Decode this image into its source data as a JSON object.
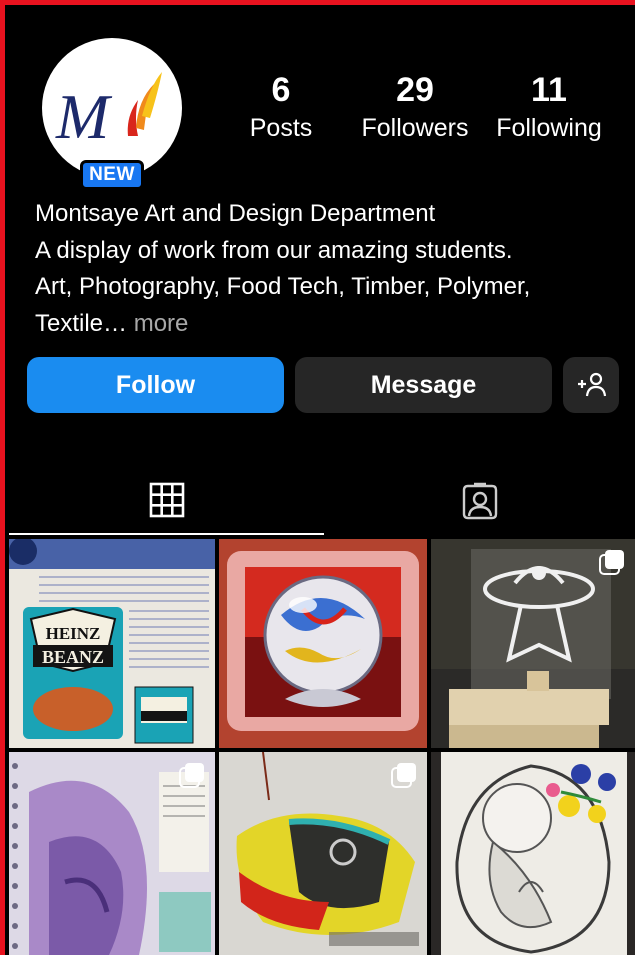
{
  "profile": {
    "avatar_logo": "MJ",
    "badge": "NEW"
  },
  "stats": [
    {
      "value": "6",
      "label": "Posts"
    },
    {
      "value": "29",
      "label": "Followers"
    },
    {
      "value": "11",
      "label": "Following"
    }
  ],
  "bio": {
    "name": "Montsaye Art and Design Department",
    "line1": "A display of work from our amazing students.",
    "line2": "Art, Photography, Food Tech, Timber, Polymer,",
    "line3": "Textile…",
    "more": "more"
  },
  "actions": {
    "follow": "Follow",
    "message": "Message",
    "add_user_icon": "add-person-icon"
  },
  "tabs": [
    {
      "icon": "grid-icon",
      "active": true
    },
    {
      "icon": "tagged-icon",
      "active": false
    }
  ],
  "posts": [
    {
      "subject": "Heinz Beanz sketchbook page",
      "text": [
        "HEINZ",
        "BEANZ"
      ],
      "multiple": false
    },
    {
      "subject": "Marble painting",
      "multiple": false
    },
    {
      "subject": "UFO acrylic sign",
      "multiple": true
    },
    {
      "subject": "Purple sketchbook drawing",
      "multiple": true
    },
    {
      "subject": "Bumper car painting",
      "multiple": true
    },
    {
      "subject": "Embroidered baby drawing",
      "multiple": false
    }
  ],
  "colors": {
    "accent": "#1a8cf0",
    "badge": "#1877f2",
    "button_secondary": "#262626",
    "frame": "#e8121f"
  }
}
